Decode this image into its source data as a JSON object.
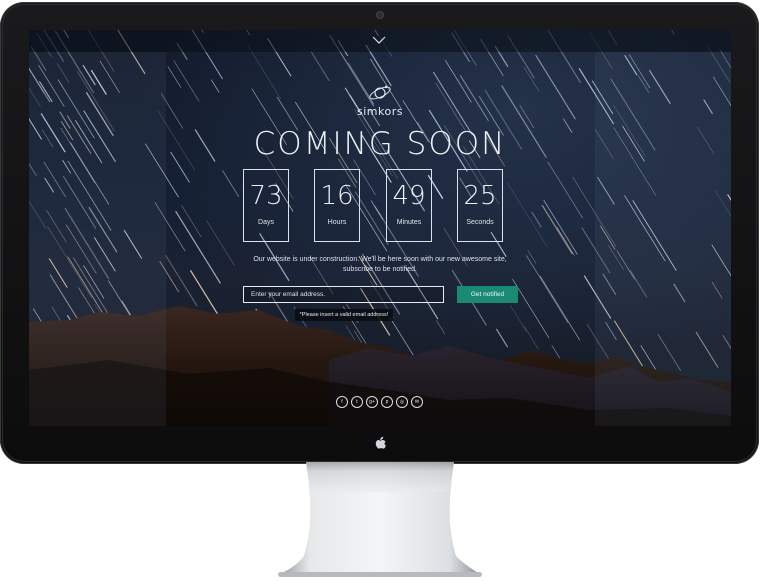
{
  "page": {
    "brand": "simkors",
    "title": "Coming soon",
    "countdown": [
      {
        "value": "73",
        "label": "Days"
      },
      {
        "value": "16",
        "label": "Hours"
      },
      {
        "value": "49",
        "label": "Minutes"
      },
      {
        "value": "25",
        "label": "Seconds"
      }
    ],
    "description_line1": "Our website is under construction. We'll be here soon with our new awesome site,",
    "description_line2": "subscribe to be notified.",
    "email_placeholder": "Enter your email address.",
    "notify_button": "Get notified",
    "error_message": "*Please insert a valid email address!",
    "socials": [
      {
        "icon": "facebook-icon",
        "glyph": "f"
      },
      {
        "icon": "twitter-icon",
        "glyph": "t"
      },
      {
        "icon": "google-plus-icon",
        "glyph": "g+"
      },
      {
        "icon": "pinterest-icon",
        "glyph": "p"
      },
      {
        "icon": "instagram-icon",
        "glyph": "◎"
      },
      {
        "icon": "email-icon",
        "glyph": "✉"
      }
    ]
  },
  "colors": {
    "accent": "#1b8a74",
    "sky": "#141c2c",
    "text": "#eef2f7",
    "bezel": "#111112"
  }
}
